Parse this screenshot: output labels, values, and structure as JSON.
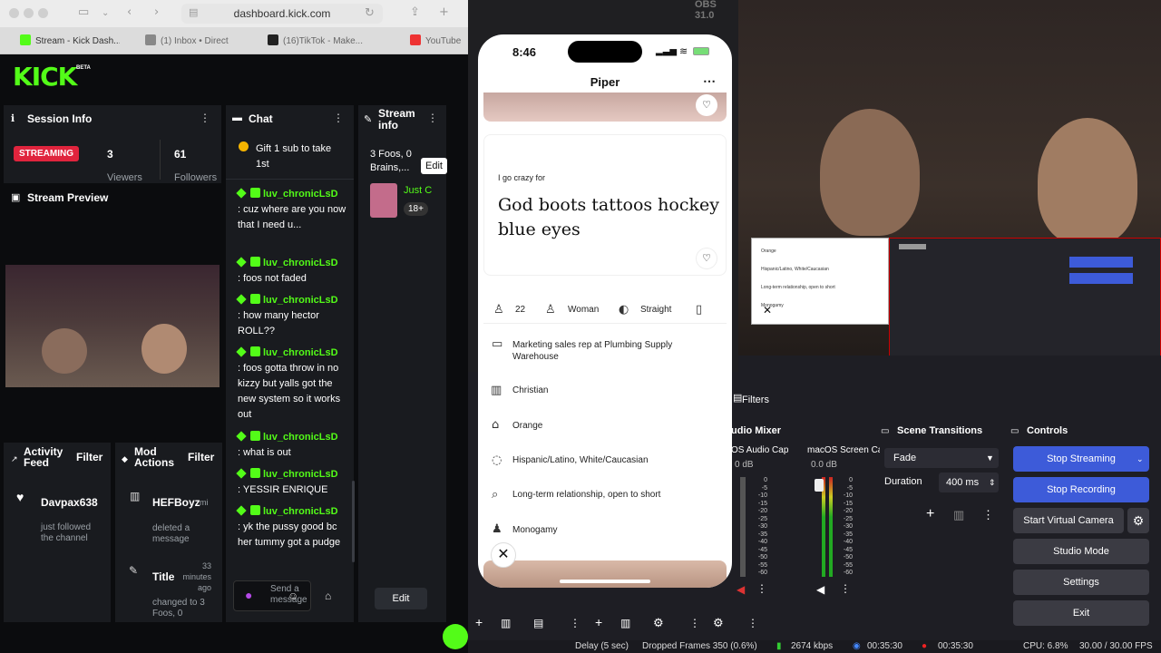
{
  "browser": {
    "url": "dashboard.kick.com",
    "tabs": [
      {
        "label": "Stream - Kick Dash..."
      },
      {
        "label": "(1) Inbox • Direct"
      },
      {
        "label": "(16)TikTok - Make..."
      },
      {
        "label": "YouTube"
      }
    ]
  },
  "kick": {
    "logo": "KICK",
    "beta": "BETA",
    "session": {
      "title": "Session Info",
      "status": "STREAMING",
      "viewers": "3",
      "viewers_label": "Viewers",
      "followers": "61",
      "followers_label": "Followers"
    },
    "preview": {
      "title": "Stream Preview"
    },
    "chat": {
      "title": "Chat",
      "gift": "Gift 1 sub to take 1st",
      "messages": [
        {
          "user": "luv_chronicLsD",
          "text": ": cuz where are you now that I need u..."
        },
        {
          "user": "luv_chronicLsD",
          "text": ": foos not faded"
        },
        {
          "user": "luv_chronicLsD",
          "text": ": how many hector ROLL??"
        },
        {
          "user": "luv_chronicLsD",
          "text": ": foos gotta throw in no kizzy but yalls got the new system so it works out"
        },
        {
          "user": "luv_chronicLsD",
          "text": ": what is out"
        },
        {
          "user": "luv_chronicLsD",
          "text": ": YESSIR ENRIQUE"
        },
        {
          "user": "luv_chronicLsD",
          "text": ": yk the pussy good bc her tummy got a pudge"
        }
      ],
      "send_placeholder": "Send a message"
    },
    "streaminfo": {
      "title": "Stream info",
      "stream_title": "3 Foos, 0 Brains,...",
      "edit": "Edit",
      "category": "Just C",
      "rating": "18+",
      "edit_bottom": "Edit"
    },
    "activity": {
      "title": "Activity Feed",
      "filter": "Filter",
      "user": "Davpax638",
      "action": "just followed the channel"
    },
    "modactions": {
      "title": "Mod Actions",
      "filter": "Filter",
      "entries": [
        {
          "user": "HEFBoyz",
          "suffix": "mi",
          "action": "deleted a message"
        },
        {
          "user": "Title",
          "time": "33 minutes ago",
          "action": "changed to 3 Foos, 0"
        }
      ]
    }
  },
  "phone": {
    "time": "8:46",
    "profile_name": "Piper",
    "prompt_label": "I go crazy for",
    "prompt_answer": "God boots tattoos hockey blue eyes",
    "stats": {
      "age": "22",
      "gender": "Woman",
      "orientation": "Straight"
    },
    "details": [
      {
        "icon": "briefcase-icon",
        "text": "Marketing sales rep at Plumbing Supply Warehouse"
      },
      {
        "icon": "book-icon",
        "text": "Christian"
      },
      {
        "icon": "home-icon",
        "text": "Orange"
      },
      {
        "icon": "ethnicity-icon",
        "text": "Hispanic/Latino, White/Caucasian"
      },
      {
        "icon": "search-icon",
        "text": "Long-term relationship, open to short"
      },
      {
        "icon": "people-icon",
        "text": "Monogamy"
      }
    ]
  },
  "obs": {
    "app_title": "OBS 31.0",
    "filters": "Filters",
    "audio_mixer": {
      "title": "udio Mixer",
      "channels": [
        {
          "name": "OS Audio Cap",
          "db": "0 dB"
        },
        {
          "name": "macOS Screen Ca",
          "db": "0.0 dB"
        }
      ],
      "scale": [
        "0",
        "-5",
        "-10",
        "-15",
        "-20",
        "-25",
        "-30",
        "-35",
        "-40",
        "-45",
        "-50",
        "-55",
        "-60"
      ]
    },
    "scene_transitions": {
      "title": "Scene Transitions",
      "transition": "Fade",
      "duration_label": "Duration",
      "duration_value": "400 ms"
    },
    "controls": {
      "title": "Controls",
      "buttons": [
        "Stop Streaming",
        "Stop Recording",
        "Start Virtual Camera",
        "Studio Mode",
        "Settings",
        "Exit"
      ]
    },
    "status": {
      "delay": "Delay (5 sec)",
      "dropped": "Dropped Frames 350 (0.6%)",
      "bitrate": "2674 kbps",
      "stream_time": "00:35:30",
      "rec_time": "00:35:30",
      "cpu": "CPU: 6.8%",
      "fps": "30.00 / 30.00 FPS"
    },
    "mini_list": [
      "Orange",
      "Hispanic/Latino, White/Caucasian",
      "Long-term relationship, open to short",
      "Monogamy"
    ]
  },
  "colors": {
    "kick_green": "#53fc18",
    "streaming_red": "#e0243d",
    "obs_blue": "#3d5bd9"
  }
}
